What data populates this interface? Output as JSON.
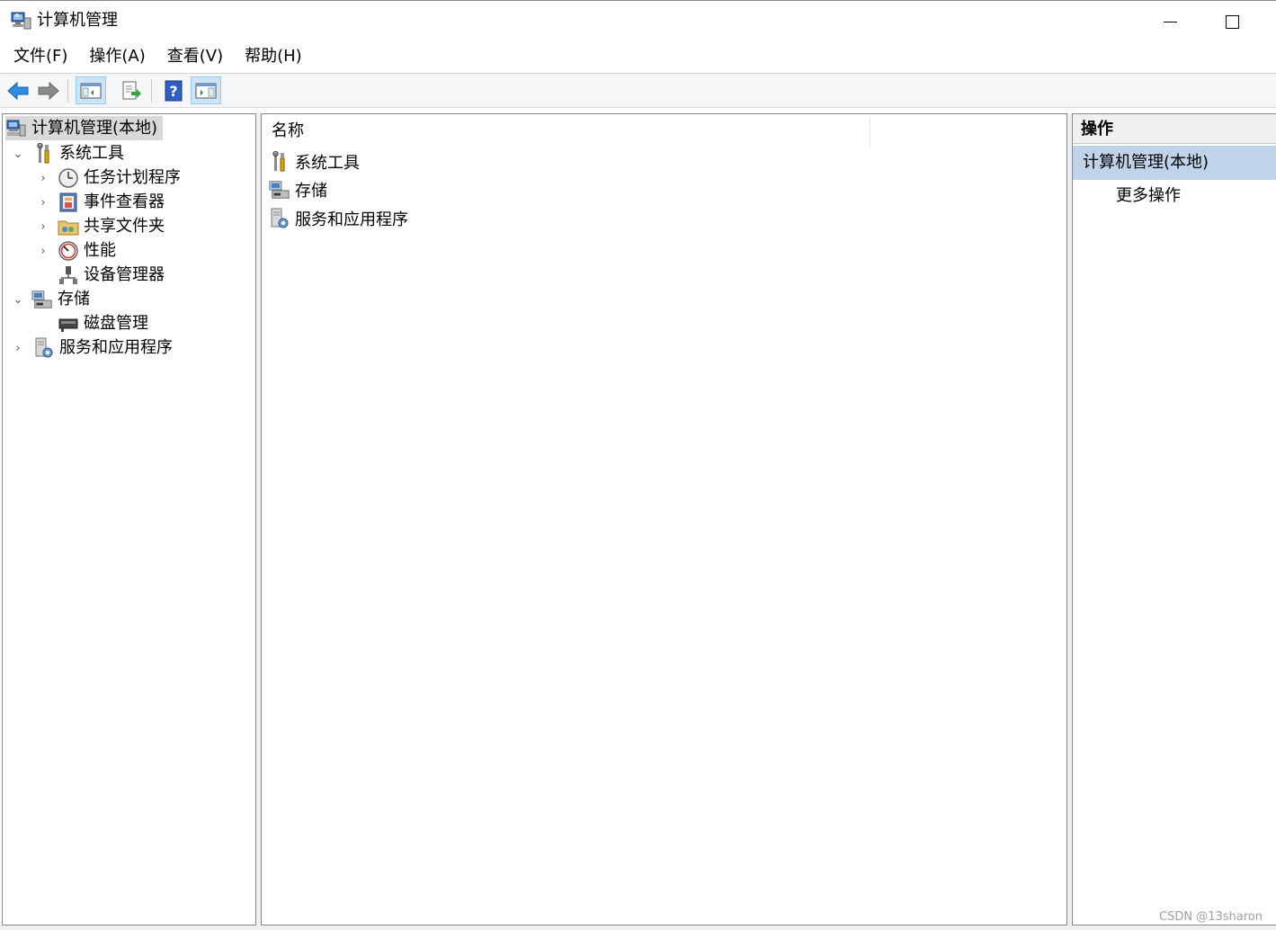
{
  "window": {
    "title": "计算机管理"
  },
  "menu": {
    "items": [
      "文件(F)",
      "操作(A)",
      "查看(V)",
      "帮助(H)"
    ]
  },
  "toolbar": {
    "buttons": [
      "back-arrow-icon",
      "forward-arrow-icon",
      "show-hide-console-tree-icon",
      "export-list-icon",
      "help-icon",
      "show-hide-action-pane-icon"
    ]
  },
  "tree": {
    "root": "计算机管理(本地)",
    "system_tools": "系统工具",
    "task_scheduler": "任务计划程序",
    "event_viewer": "事件查看器",
    "shared_folders": "共享文件夹",
    "performance": "性能",
    "device_manager": "设备管理器",
    "storage": "存储",
    "disk_management": "磁盘管理",
    "services_apps": "服务和应用程序"
  },
  "list": {
    "column_name": "名称",
    "rows": [
      "系统工具",
      "存储",
      "服务和应用程序"
    ]
  },
  "actions": {
    "header": "操作",
    "selected": "计算机管理(本地)",
    "more": "更多操作"
  },
  "watermark": "CSDN @13sharon",
  "colors": {
    "selection": "#bfd3ea",
    "toolbar_active": "#cce4f7",
    "tree_root_bg": "#d9d9d9"
  }
}
